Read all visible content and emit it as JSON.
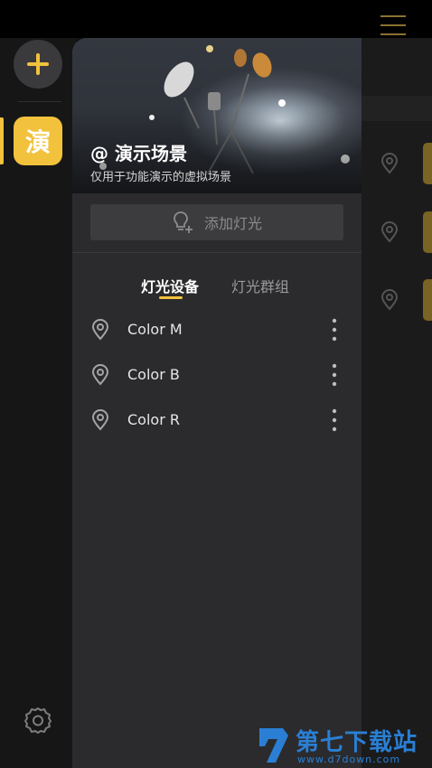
{
  "rail": {
    "add_label": "+",
    "scene_tile_label": "演",
    "settings_icon": "gear-icon"
  },
  "scene": {
    "title": "@ 演示场景",
    "subtitle": "仅用于功能演示的虚拟场景"
  },
  "add_light": {
    "label": "添加灯光",
    "icon": "bulb-plus-icon"
  },
  "tabs": [
    {
      "label": "灯光设备",
      "active": true
    },
    {
      "label": "灯光群组",
      "active": false
    }
  ],
  "lights": [
    {
      "name": "Color M"
    },
    {
      "name": "Color B"
    },
    {
      "name": "Color R"
    }
  ],
  "watermark": {
    "name": "第七下载站",
    "url": "www.d7down.com"
  },
  "colors": {
    "accent": "#f2c23c",
    "panel": "#2b2b2d",
    "background": "#111112"
  }
}
